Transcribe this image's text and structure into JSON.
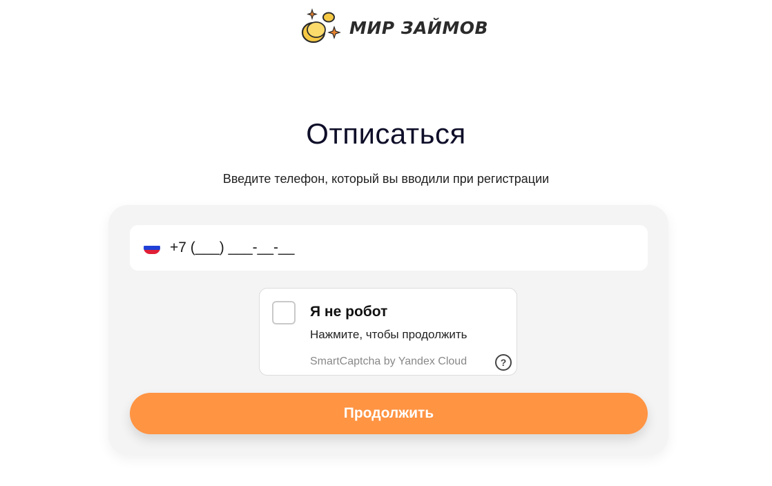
{
  "header": {
    "logo_text": "МИР ЗАЙМОВ",
    "logo_icon": "coins-sparkle-icon"
  },
  "main": {
    "title": "Отписаться",
    "subtitle": "Введите телефон, который вы вводили при регистрации"
  },
  "form": {
    "phone_country_icon": "russia-flag-icon",
    "phone_placeholder": "+7 (___) ___-__-__",
    "phone_value": "",
    "captcha": {
      "title": "Я не робот",
      "hint": "Нажмите, чтобы продолжить",
      "brand": "SmartCaptcha by Yandex Cloud",
      "help_symbol": "?",
      "checked": false
    },
    "submit_label": "Продолжить"
  },
  "colors": {
    "accent": "#ff9443",
    "card_bg": "#f4f4f4",
    "title": "#0f0f2a",
    "coin": "#f6c945",
    "sparkle": "#e8842f"
  }
}
